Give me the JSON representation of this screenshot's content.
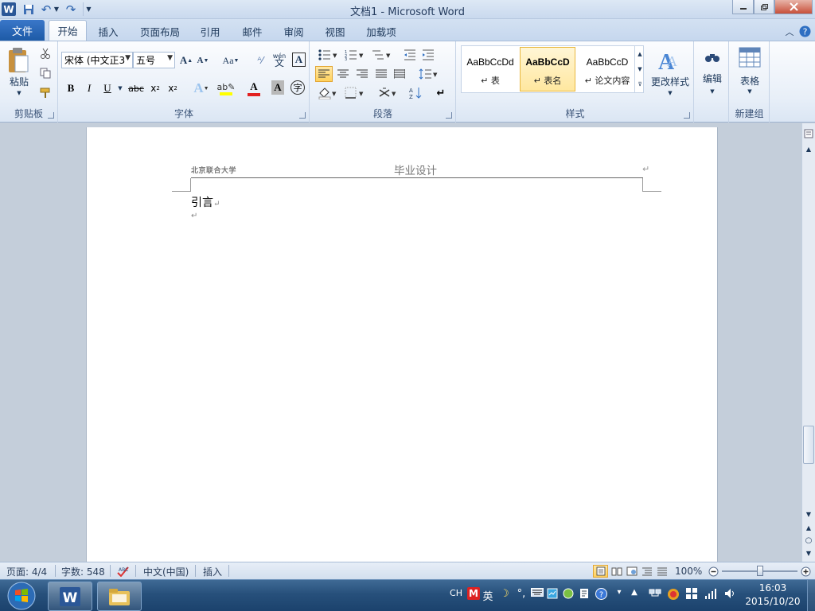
{
  "window": {
    "title": "文档1  -  Microsoft Word"
  },
  "tabs": {
    "file": "文件",
    "items": [
      "开始",
      "插入",
      "页面布局",
      "引用",
      "邮件",
      "审阅",
      "视图",
      "加载项"
    ]
  },
  "ribbon": {
    "clipboard": {
      "label": "剪贴板",
      "paste": "粘贴"
    },
    "font": {
      "label": "字体",
      "font_name": "宋体 (中文正文)",
      "font_size": "五号",
      "shown_font_name": "宋体 (中文正3"
    },
    "paragraph": {
      "label": "段落"
    },
    "styles": {
      "label": "样式",
      "items": [
        {
          "sample": "AaBbCcDd",
          "name": "↵ 表"
        },
        {
          "sample": "AaBbCcD",
          "name": "↵ 表名"
        },
        {
          "sample": "AaBbCcD",
          "name": "↵ 论文内容"
        }
      ],
      "change_styles": "更改样式"
    },
    "editing": {
      "label": "编辑"
    },
    "table": {
      "label": "表格",
      "group_label": "新建组"
    }
  },
  "document": {
    "header_left": "北京联合大学",
    "header_center": "毕业设计",
    "heading": "引言"
  },
  "status": {
    "page": "页面: 4/4",
    "words": "字数: 548",
    "language": "中文(中国)",
    "mode": "插入",
    "zoom": "100%",
    "zoom_fraction": 0.5
  },
  "taskbar": {
    "ime": "CH",
    "ime_lang": "英",
    "time": "16:03",
    "date": "2015/10/20"
  }
}
